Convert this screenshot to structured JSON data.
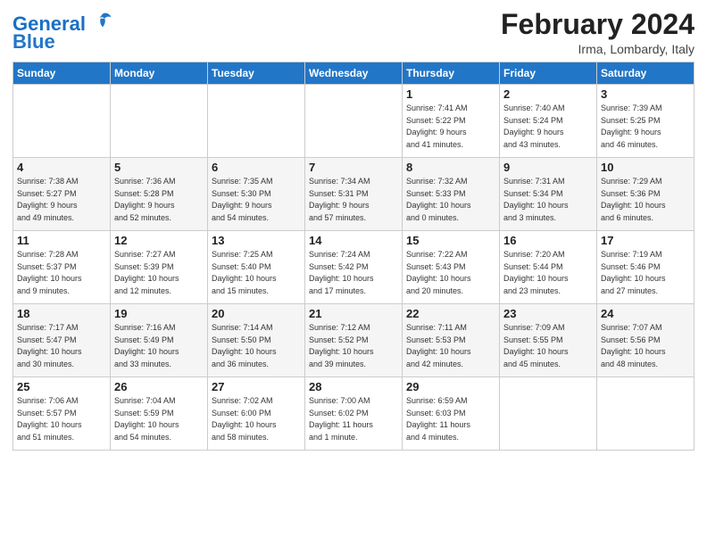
{
  "header": {
    "logo_general": "General",
    "logo_blue": "Blue",
    "month_year": "February 2024",
    "location": "Irma, Lombardy, Italy"
  },
  "weekdays": [
    "Sunday",
    "Monday",
    "Tuesday",
    "Wednesday",
    "Thursday",
    "Friday",
    "Saturday"
  ],
  "weeks": [
    [
      {
        "day": "",
        "detail": ""
      },
      {
        "day": "",
        "detail": ""
      },
      {
        "day": "",
        "detail": ""
      },
      {
        "day": "",
        "detail": ""
      },
      {
        "day": "1",
        "detail": "Sunrise: 7:41 AM\nSunset: 5:22 PM\nDaylight: 9 hours\nand 41 minutes."
      },
      {
        "day": "2",
        "detail": "Sunrise: 7:40 AM\nSunset: 5:24 PM\nDaylight: 9 hours\nand 43 minutes."
      },
      {
        "day": "3",
        "detail": "Sunrise: 7:39 AM\nSunset: 5:25 PM\nDaylight: 9 hours\nand 46 minutes."
      }
    ],
    [
      {
        "day": "4",
        "detail": "Sunrise: 7:38 AM\nSunset: 5:27 PM\nDaylight: 9 hours\nand 49 minutes."
      },
      {
        "day": "5",
        "detail": "Sunrise: 7:36 AM\nSunset: 5:28 PM\nDaylight: 9 hours\nand 52 minutes."
      },
      {
        "day": "6",
        "detail": "Sunrise: 7:35 AM\nSunset: 5:30 PM\nDaylight: 9 hours\nand 54 minutes."
      },
      {
        "day": "7",
        "detail": "Sunrise: 7:34 AM\nSunset: 5:31 PM\nDaylight: 9 hours\nand 57 minutes."
      },
      {
        "day": "8",
        "detail": "Sunrise: 7:32 AM\nSunset: 5:33 PM\nDaylight: 10 hours\nand 0 minutes."
      },
      {
        "day": "9",
        "detail": "Sunrise: 7:31 AM\nSunset: 5:34 PM\nDaylight: 10 hours\nand 3 minutes."
      },
      {
        "day": "10",
        "detail": "Sunrise: 7:29 AM\nSunset: 5:36 PM\nDaylight: 10 hours\nand 6 minutes."
      }
    ],
    [
      {
        "day": "11",
        "detail": "Sunrise: 7:28 AM\nSunset: 5:37 PM\nDaylight: 10 hours\nand 9 minutes."
      },
      {
        "day": "12",
        "detail": "Sunrise: 7:27 AM\nSunset: 5:39 PM\nDaylight: 10 hours\nand 12 minutes."
      },
      {
        "day": "13",
        "detail": "Sunrise: 7:25 AM\nSunset: 5:40 PM\nDaylight: 10 hours\nand 15 minutes."
      },
      {
        "day": "14",
        "detail": "Sunrise: 7:24 AM\nSunset: 5:42 PM\nDaylight: 10 hours\nand 17 minutes."
      },
      {
        "day": "15",
        "detail": "Sunrise: 7:22 AM\nSunset: 5:43 PM\nDaylight: 10 hours\nand 20 minutes."
      },
      {
        "day": "16",
        "detail": "Sunrise: 7:20 AM\nSunset: 5:44 PM\nDaylight: 10 hours\nand 23 minutes."
      },
      {
        "day": "17",
        "detail": "Sunrise: 7:19 AM\nSunset: 5:46 PM\nDaylight: 10 hours\nand 27 minutes."
      }
    ],
    [
      {
        "day": "18",
        "detail": "Sunrise: 7:17 AM\nSunset: 5:47 PM\nDaylight: 10 hours\nand 30 minutes."
      },
      {
        "day": "19",
        "detail": "Sunrise: 7:16 AM\nSunset: 5:49 PM\nDaylight: 10 hours\nand 33 minutes."
      },
      {
        "day": "20",
        "detail": "Sunrise: 7:14 AM\nSunset: 5:50 PM\nDaylight: 10 hours\nand 36 minutes."
      },
      {
        "day": "21",
        "detail": "Sunrise: 7:12 AM\nSunset: 5:52 PM\nDaylight: 10 hours\nand 39 minutes."
      },
      {
        "day": "22",
        "detail": "Sunrise: 7:11 AM\nSunset: 5:53 PM\nDaylight: 10 hours\nand 42 minutes."
      },
      {
        "day": "23",
        "detail": "Sunrise: 7:09 AM\nSunset: 5:55 PM\nDaylight: 10 hours\nand 45 minutes."
      },
      {
        "day": "24",
        "detail": "Sunrise: 7:07 AM\nSunset: 5:56 PM\nDaylight: 10 hours\nand 48 minutes."
      }
    ],
    [
      {
        "day": "25",
        "detail": "Sunrise: 7:06 AM\nSunset: 5:57 PM\nDaylight: 10 hours\nand 51 minutes."
      },
      {
        "day": "26",
        "detail": "Sunrise: 7:04 AM\nSunset: 5:59 PM\nDaylight: 10 hours\nand 54 minutes."
      },
      {
        "day": "27",
        "detail": "Sunrise: 7:02 AM\nSunset: 6:00 PM\nDaylight: 10 hours\nand 58 minutes."
      },
      {
        "day": "28",
        "detail": "Sunrise: 7:00 AM\nSunset: 6:02 PM\nDaylight: 11 hours\nand 1 minute."
      },
      {
        "day": "29",
        "detail": "Sunrise: 6:59 AM\nSunset: 6:03 PM\nDaylight: 11 hours\nand 4 minutes."
      },
      {
        "day": "",
        "detail": ""
      },
      {
        "day": "",
        "detail": ""
      }
    ]
  ]
}
